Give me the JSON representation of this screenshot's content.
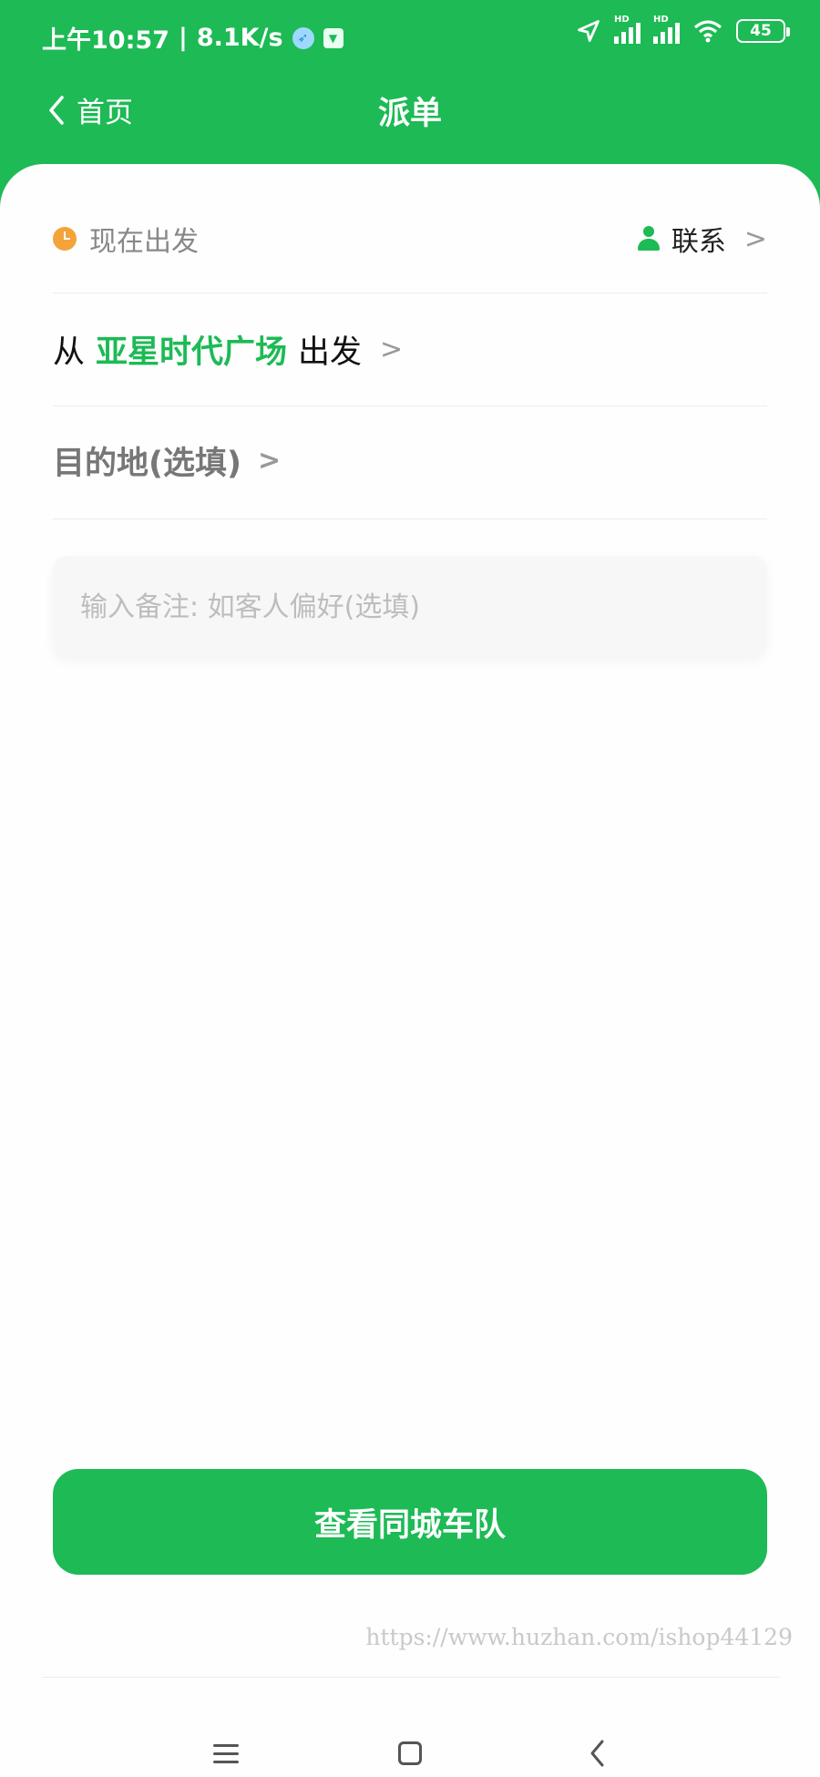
{
  "status_bar": {
    "time": "上午10:57",
    "speed": "8.1K/s",
    "battery": "45",
    "hd_label": "HD"
  },
  "nav": {
    "back_label": "首页",
    "title": "派单"
  },
  "form": {
    "departure_time": "现在出发",
    "contact_label": "联系",
    "from_prefix": "从",
    "from_place": "亚星时代广场",
    "from_suffix": "出发",
    "destination": "目的地(选填)",
    "note_placeholder": "输入备注: 如客人偏好(选填)",
    "chevron": ">"
  },
  "action": {
    "button_label": "查看同城车队"
  },
  "watermark": "https://www.huzhan.com/ishop44129",
  "colors": {
    "brand_green": "#1dba55",
    "clock_orange": "#f4a33a"
  }
}
